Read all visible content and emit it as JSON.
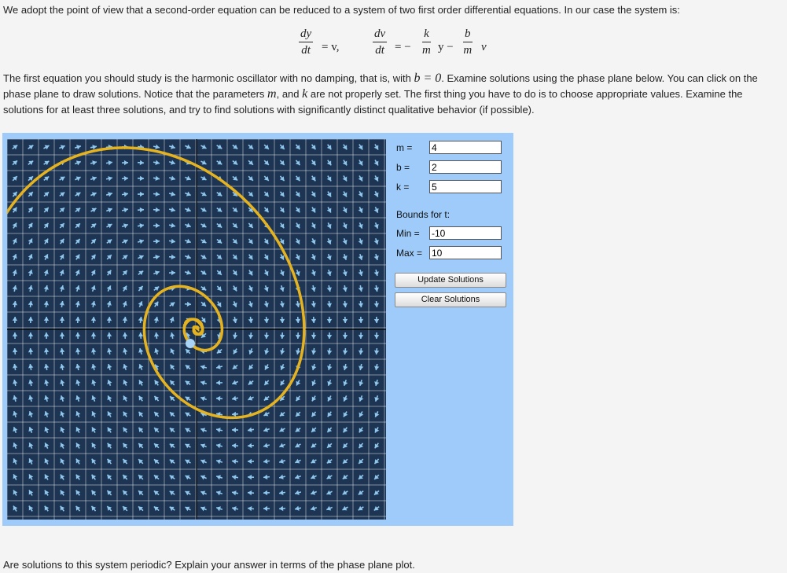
{
  "intro": "We adopt the point of view that a second-order equation can be reduced to a system of two first order differential equations. In our case the system is:",
  "equations": {
    "eq1_num": "dy",
    "eq1_den": "dt",
    "eq1_rhs": "= v,",
    "eq2_num": "dv",
    "eq2_den": "dt",
    "eq2_eq": "= −",
    "k_num": "k",
    "m_den1": "m",
    "y_minus": "y −",
    "b_num": "b",
    "m_den2": "m",
    "v": "v"
  },
  "body": {
    "part1": "The first equation you should study is the harmonic oscillator with no damping, that is, with ",
    "cond": "b = 0",
    "part2": ". Examine solutions using the phase plane below. You can click on the phase plane to draw solutions. Notice that the parameters ",
    "m": "m",
    "comma_and": ", and ",
    "k": "k",
    "part3": " are not properly set. The first thing you have to do is to choose appropriate values. Examine the solutions for at least three solutions, and try to find solutions with significantly distinct qualitative behavior (if possible)."
  },
  "controls": {
    "m_label": "m =",
    "m_value": "4",
    "b_label": "b =",
    "b_value": "2",
    "k_label": "k =",
    "k_value": "5",
    "bounds_label": "Bounds for t:",
    "min_label": "Min =",
    "min_value": "-10",
    "max_label": "Max =",
    "max_value": "10",
    "update_button": "Update Solutions",
    "clear_button": "Clear Solutions"
  },
  "colors": {
    "plot_background": "#1d3552",
    "grid": "#ffffff",
    "arrows": "#8fc6ee",
    "solution": "#e6b320",
    "panel": "#9ecbfa"
  },
  "question": "Are solutions to this system periodic? Explain your answer in terms of the phase plane plot."
}
